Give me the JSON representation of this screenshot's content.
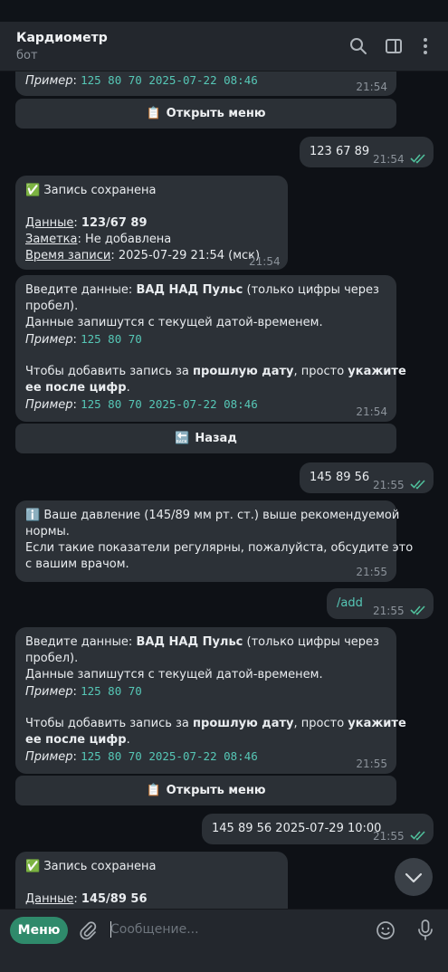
{
  "header": {
    "title": "Кардиометр",
    "subtitle": "бот",
    "icons": [
      "search-icon",
      "sidebar-toggle-icon",
      "more-vertical-icon"
    ]
  },
  "messages": {
    "m0": {
      "ex_label": "Пример",
      "ex_colon": ":",
      "ex_value": "125 80 70 2025-07-22 08:46",
      "time": "21:54"
    },
    "kb0": {
      "icon": "📋",
      "label": "Открыть меню"
    },
    "o1": {
      "text": "123 67 89",
      "time": "21:54"
    },
    "m2": {
      "title_icon": "✅",
      "title": "Запись сохранена",
      "l1_key": "Данные",
      "l1_sep": ": ",
      "l1_val": "123/67 89",
      "l2_key": "Заметка",
      "l2_val": ": Не добавлена",
      "l3_key": "Время записи",
      "l3_val": ": 2025-07-29 21:54 (мск)",
      "time": "21:54"
    },
    "m3": {
      "a1": "Введите данные: ",
      "a2": "ВАД НАД Пульс",
      "a3": " (только цифры через",
      "b1": "пробел).",
      "c1": "Данные запишутся с текущей датой-временем.",
      "d_label": "Пример",
      "d_colon": ":",
      "d_value": "125 80 70",
      "e1": "Чтобы добавить запись за ",
      "e2": "прошлую дату",
      "e3": ", просто ",
      "e4": "укажите",
      "f1": "ее после цифр",
      "f2": ".",
      "g_label": "Пример",
      "g_colon": ":",
      "g_value": "125 80 70 2025-07-22 08:46",
      "time": "21:54"
    },
    "kb1": {
      "icon": "🔙",
      "label": "Назад"
    },
    "o4": {
      "text": "145 89 56",
      "time": "21:55"
    },
    "m5": {
      "icon": "ℹ️",
      "l1": "Ваше давление (145/89 мм рт. ст.) выше рекомендуемой",
      "l2": "нормы.",
      "l3": "Если такие показатели регулярны, пожалуйста, обсудите это",
      "l4": "с вашим врачом.",
      "time": "21:55"
    },
    "o6": {
      "text": "/add",
      "time": "21:55"
    },
    "m7": {
      "a1": "Введите данные: ",
      "a2": "ВАД НАД Пульс",
      "a3": " (только цифры через",
      "b1": "пробел).",
      "c1": "Данные запишутся с текущей датой-временем.",
      "d_label": "Пример",
      "d_colon": ":",
      "d_value": "125 80 70",
      "e1": "Чтобы добавить запись за ",
      "e2": "прошлую дату",
      "e3": ", просто ",
      "e4": "укажите",
      "f1": "ее после цифр",
      "f2": ".",
      "g_label": "Пример",
      "g_colon": ":",
      "g_value": "125 80 70 2025-07-22 08:46",
      "time": "21:55"
    },
    "kb2": {
      "icon": "📋",
      "label": "Открыть меню"
    },
    "o8": {
      "text": "145 89 56 2025-07-29 10:00",
      "time": "21:55"
    },
    "m9": {
      "title_icon": "✅",
      "title": "Запись сохранена",
      "l1_key": "Данные",
      "l1_sep": ": ",
      "l1_val": "145/89 56"
    }
  },
  "bottom": {
    "menu_label": "Меню",
    "placeholder": "Сообщение...",
    "icons": [
      "attach-icon",
      "emoji-icon",
      "microphone-icon"
    ]
  },
  "colors": {
    "background": "#0e1116",
    "bubble": "#2c3137",
    "header": "#23272d",
    "accent_green": "#2f8a6b",
    "code_teal": "#56c7b6",
    "read_ticks": "#4fbf9b"
  }
}
